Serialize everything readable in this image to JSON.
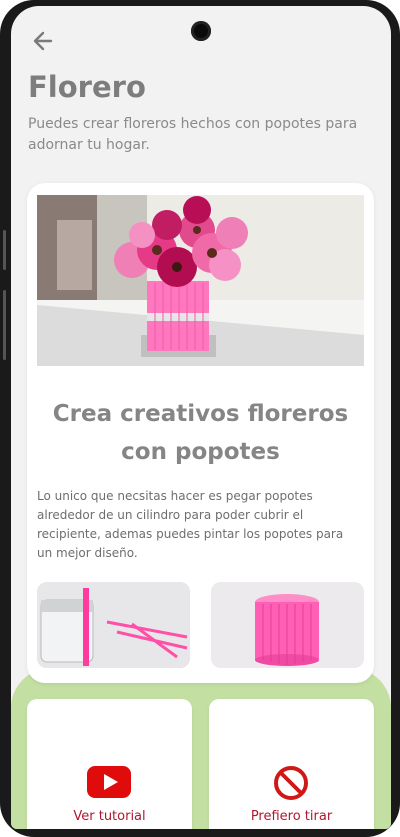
{
  "header": {
    "back_icon": "arrow-left-icon",
    "title": "Florero",
    "subtitle": "Puedes crear floreros hechos con popotes para adornar tu hogar."
  },
  "card": {
    "title": "Crea creativos floreros con popotes",
    "body": "Lo unico que necsitas hacer es pegar popotes alrededor de un cilindro para poder cubrir el recipiente, ademas puedes pintar los popotes para un mejor diseño."
  },
  "actions": [
    {
      "label": "Ver tutorial",
      "icon": "youtube-icon",
      "color": "#e00b0b"
    },
    {
      "label": "Prefiero tirar",
      "icon": "prohibited-icon",
      "color": "#d01818"
    }
  ],
  "colors": {
    "accent_green": "#c3dfa1",
    "pink": "#ff5fae",
    "label_red": "#b0172f"
  }
}
